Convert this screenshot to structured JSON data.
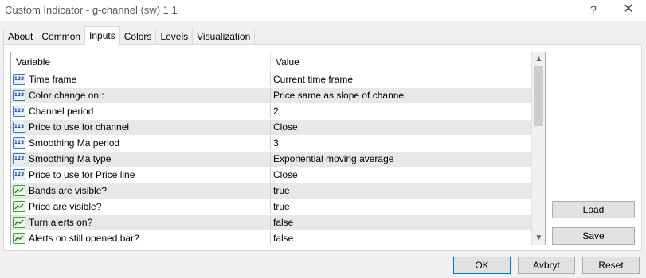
{
  "window": {
    "title": "Custom Indicator - g-channel (sw) 1.1",
    "help_label": "?",
    "close_label": "✕"
  },
  "tabs": [
    {
      "label": "About"
    },
    {
      "label": "Common"
    },
    {
      "label": "Inputs"
    },
    {
      "label": "Colors"
    },
    {
      "label": "Levels"
    },
    {
      "label": "Visualization"
    }
  ],
  "active_tab": "Inputs",
  "grid": {
    "col_variable": "Variable",
    "col_value": "Value",
    "scroll_up": "▲",
    "scroll_down": "▼",
    "rows": [
      {
        "icon": "123",
        "name": "Time frame",
        "value": "Current time frame"
      },
      {
        "icon": "123",
        "name": "Color change on::",
        "value": "Price same as slope of channel"
      },
      {
        "icon": "123",
        "name": "Channel period",
        "value": "2"
      },
      {
        "icon": "123",
        "name": "Price to use for channel",
        "value": "Close"
      },
      {
        "icon": "123",
        "name": "Smoothing Ma period",
        "value": "3"
      },
      {
        "icon": "123",
        "name": "Smoothing Ma type",
        "value": "Exponential moving average"
      },
      {
        "icon": "123",
        "name": "Price to use for Price line",
        "value": "Close"
      },
      {
        "icon": "bool",
        "name": "Bands are visible?",
        "value": "true"
      },
      {
        "icon": "bool",
        "name": "Price are visible?",
        "value": "true"
      },
      {
        "icon": "bool",
        "name": "Turn alerts on?",
        "value": "false"
      },
      {
        "icon": "bool",
        "name": "Alerts on still opened bar?",
        "value": "false"
      }
    ]
  },
  "buttons": {
    "load": "Load",
    "save": "Save",
    "ok": "OK",
    "cancel": "Avbryt",
    "reset": "Reset"
  }
}
